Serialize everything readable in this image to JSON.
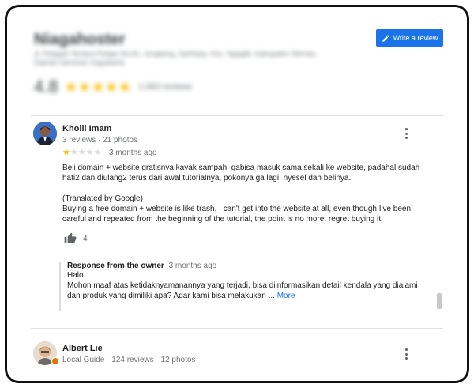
{
  "header": {
    "business_name": "Niagahoster",
    "address": "Jl. Palagan Tentara Pelajar No.81, Jongkang, Sariharjo, Kec. Ngaglik, Kabupaten Sleman, Daerah Istimewa Yogyakarta",
    "rating": "4.8",
    "stars": "★★★★★",
    "review_count": "1,583 reviews",
    "write_review_label": "Write a review"
  },
  "reviews": [
    {
      "name": "Kholil Imam",
      "meta": "3 reviews · 21 photos",
      "rating": 1,
      "time": "3 months ago",
      "text": "Beli domain + website gratisnya kayak sampah, gabisa masuk sama sekali ke website, padahal sudah hati2 dan diulang2 terus dari awal tutorialnya, pokonya ga lagi. nyesel dah belinya.",
      "translated_label": "(Translated by Google)",
      "translation": "Buying a free domain + website is like trash, I can't get into the website at all, even though I've been careful and repeated from the beginning of the tutorial, the point is no more. regret buying it.",
      "likes": "4",
      "owner_response": {
        "title": "Response from the owner",
        "time": "3 months ago",
        "line1": "Halo",
        "line2": "Mohon maaf atas ketidaknyamanannya yang terjadi, bisa diinformasikan detail kendala yang dialami dan produk yang dimiliki apa? Agar kami bisa melakukan ...",
        "more_label": "More"
      }
    },
    {
      "name": "Albert Lie",
      "meta_guide": "Local Guide",
      "meta": "· 124 reviews · 12 photos"
    }
  ],
  "colors": {
    "accent": "#1a73e8",
    "star": "#fbbc04"
  }
}
